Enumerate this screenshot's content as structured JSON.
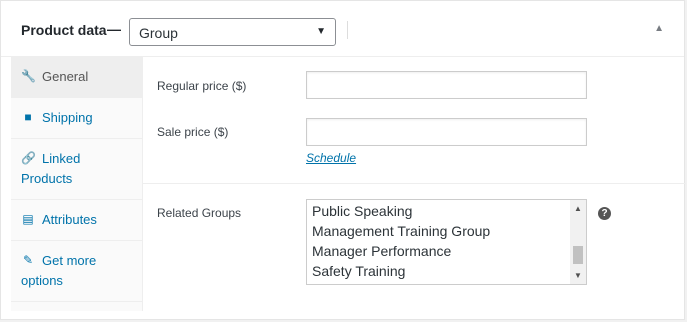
{
  "header": {
    "title": "Product data",
    "dash": "—",
    "product_type": "Group",
    "caret": "▼",
    "collapse": "▲"
  },
  "tabs": [
    {
      "icon": "wrench-icon",
      "glyph": "🔧",
      "label": "General",
      "active": true
    },
    {
      "icon": "truck-icon",
      "glyph": "■",
      "label": "Shipping",
      "active": false
    },
    {
      "icon": "link-icon",
      "glyph": "🔗",
      "label": "Linked Products",
      "active": false
    },
    {
      "icon": "list-icon",
      "glyph": "▤",
      "label": "Attributes",
      "active": false
    },
    {
      "icon": "plugin-icon",
      "glyph": "✎",
      "label": "Get more options",
      "active": false
    }
  ],
  "fields": {
    "regular_price_label": "Regular price ($)",
    "regular_price_value": "",
    "sale_price_label": "Sale price ($)",
    "sale_price_value": "",
    "schedule_link": "Schedule",
    "related_groups_label": "Related Groups",
    "related_groups_options": [
      "Public Speaking",
      "Management Training Group",
      "Manager Performance",
      "Safety Training"
    ],
    "help": "?"
  },
  "colors": {
    "link": "#0073aa",
    "border": "#e5e5e5",
    "tab_active_bg": "#eeeeee"
  }
}
